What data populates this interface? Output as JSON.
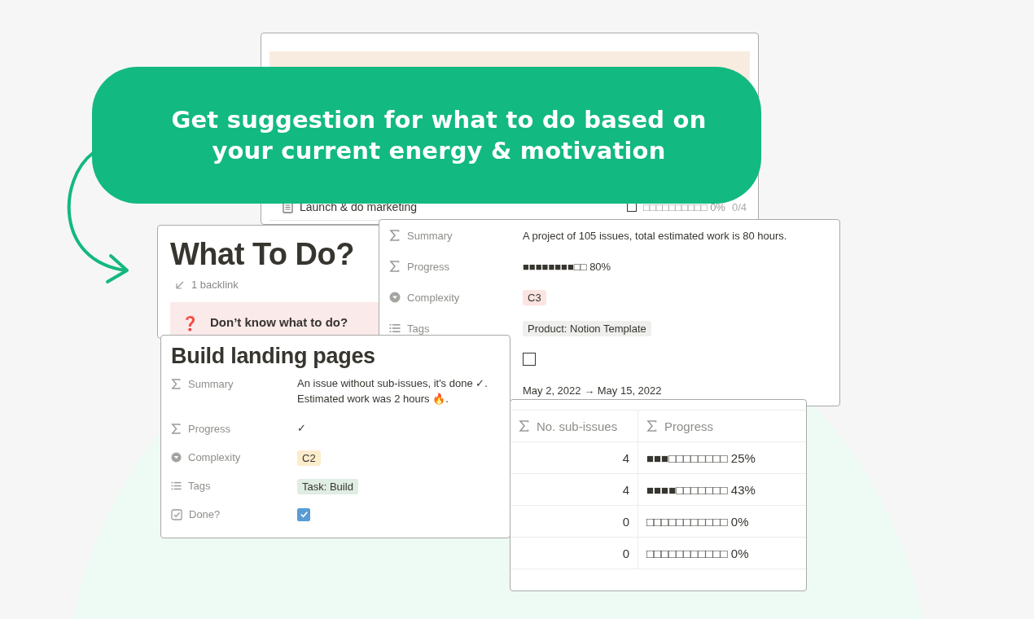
{
  "banner": {
    "lines": [
      "Get suggestion for what to do based on",
      "your current energy & motivation"
    ]
  },
  "background_card": {
    "row": {
      "title": "Launch & do marketing",
      "done": false,
      "progress": "□□□□□□□□□□ 0%",
      "count": "0/4"
    }
  },
  "page": {
    "title": "What To Do?",
    "backlinks": "1 backlink",
    "callout": {
      "icon": "❓",
      "text": "Don’t know what to do?"
    }
  },
  "project_properties": [
    {
      "kind": "formula",
      "label": "Summary",
      "value": "A project of 105 issues, total estimated work is 80 hours."
    },
    {
      "kind": "formula",
      "label": "Progress",
      "value": "■■■■■■■■□□ 80%"
    },
    {
      "kind": "select",
      "label": "Complexity",
      "value": "C3",
      "color": "#fbe4e1"
    },
    {
      "kind": "tags",
      "label": "Tags",
      "value": "Product: Notion Template",
      "color": "#efefed"
    },
    {
      "kind": "checkbox",
      "checked": false
    },
    {
      "kind": "date",
      "value": "May 2, 2022 → May 15, 2022"
    }
  ],
  "issue": {
    "title": "Build landing pages",
    "properties": [
      {
        "kind": "formula",
        "label": "Summary",
        "value": "An issue without sub-issues, it's done ✓. Estimated work was 2 hours 🔥."
      },
      {
        "kind": "formula",
        "label": "Progress",
        "value": "✓"
      },
      {
        "kind": "select",
        "label": "Complexity",
        "value": "C2",
        "color": "#fbeccc"
      },
      {
        "kind": "tags",
        "label": "Tags",
        "value": "Task: Build",
        "color": "#dfede2"
      },
      {
        "kind": "checkbox",
        "label": "Done?",
        "checked": true
      }
    ]
  },
  "table": {
    "columns": [
      "No. sub-issues",
      "Progress"
    ],
    "rows": [
      {
        "count": "4",
        "progress": "■■■□□□□□□□□ 25%"
      },
      {
        "count": "4",
        "progress": "■■■■□□□□□□□ 43%"
      },
      {
        "count": "0",
        "progress": "□□□□□□□□□□□ 0%"
      },
      {
        "count": "0",
        "progress": "□□□□□□□□□□□ 0%"
      }
    ]
  }
}
